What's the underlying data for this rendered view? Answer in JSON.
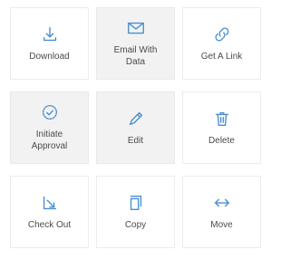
{
  "accent": "#4a8ed1",
  "actions": [
    {
      "label": "Download",
      "icon": "download-icon"
    },
    {
      "label": "Email With\nData",
      "icon": "mail-icon"
    },
    {
      "label": "Get A Link",
      "icon": "link-icon"
    },
    {
      "label": "Initiate\nApproval",
      "icon": "check-circle-icon"
    },
    {
      "label": "Edit",
      "icon": "pencil-icon"
    },
    {
      "label": "Delete",
      "icon": "trash-icon"
    },
    {
      "label": "Check Out",
      "icon": "checkout-icon"
    },
    {
      "label": "Copy",
      "icon": "copy-icon"
    },
    {
      "label": "Move",
      "icon": "move-icon"
    }
  ]
}
